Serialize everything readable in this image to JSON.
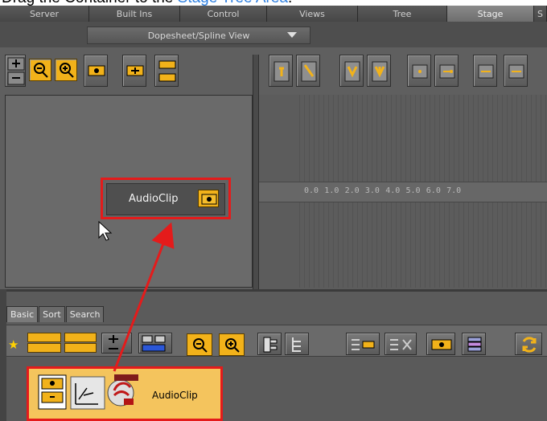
{
  "instruction": {
    "prefix": "Drag the Container to the ",
    "link": "Stage Tree Area",
    "suffix": "."
  },
  "top_tabs": [
    "Server",
    "Built Ins",
    "Control",
    "Views",
    "Tree",
    "Stage",
    "S"
  ],
  "active_top_tab": "Stage",
  "view_selector": {
    "label": "Dopesheet/Spline View"
  },
  "timeline": {
    "ruler_labels": [
      "0.0",
      "1.0",
      "2.0",
      "3.0",
      "4.0",
      "5.0",
      "6.0",
      "7.0"
    ]
  },
  "stage_node": {
    "label": "AudioClip",
    "icon": "container-icon"
  },
  "lower_tabs": [
    "Basic",
    "Sort",
    "Search"
  ],
  "active_lower_tab": "Basic",
  "container_item": {
    "label": "AudioClip",
    "icon": "audio-clip-icon"
  },
  "colors": {
    "highlight": "#e41b1b",
    "accent_yellow": "#f2b21a",
    "link": "#2d7fe0",
    "panel_dark": "#4e4e4e",
    "panel_mid": "#6a6a6a"
  }
}
